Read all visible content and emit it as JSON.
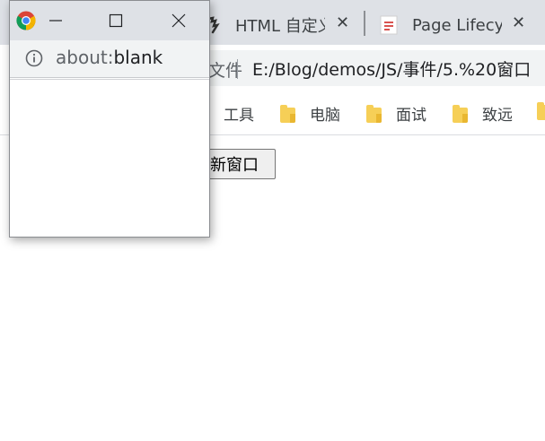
{
  "tabs": [
    {
      "title": "HTML 自定义",
      "close": "✕"
    },
    {
      "title": "Page Lifecycle",
      "close": "✕"
    }
  ],
  "omnibox": {
    "label": "文件",
    "url": "E:/Blog/demos/JS/事件/5.%20窗口"
  },
  "bookmarks": [
    {
      "label": "工具",
      "icon": "folder-icon"
    },
    {
      "label": "电脑",
      "icon": "folder-icon"
    },
    {
      "label": "面试",
      "icon": "folder-icon"
    },
    {
      "label": "致远",
      "icon": "folder-icon"
    }
  ],
  "page": {
    "button_label": "新窗口"
  },
  "popup": {
    "url_scheme": "about:",
    "url_rest": "blank"
  },
  "colors": {
    "tabstrip": "#dee1e6",
    "omnibox": "#f1f3f4",
    "folder": "#f6cf57"
  }
}
